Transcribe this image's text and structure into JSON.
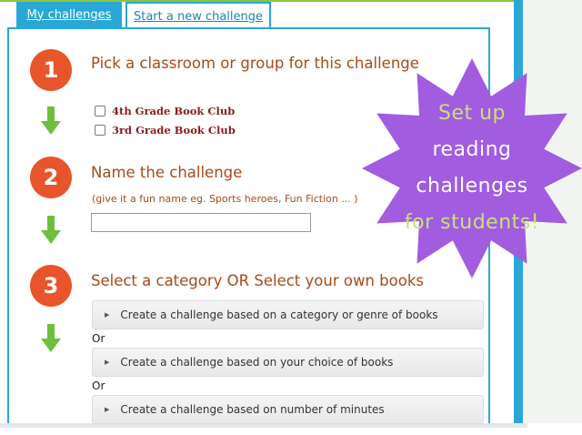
{
  "tabs": [
    {
      "label": "My challenges"
    },
    {
      "label": "Start a new challenge"
    }
  ],
  "steps": [
    {
      "number": "1",
      "title": "Pick a classroom or group for this challenge"
    },
    {
      "number": "2",
      "title": "Name the challenge",
      "hint": "(give it a fun name eg. Sports heroes, Fun Fiction ... )"
    },
    {
      "number": "3",
      "title": "Select a category OR Select your own books"
    }
  ],
  "groups": [
    {
      "label": "4th Grade Book Club"
    },
    {
      "label": "3rd Grade Book Club"
    }
  ],
  "name_field": {
    "value": "",
    "placeholder": ""
  },
  "options": [
    {
      "label": "Create a challenge based on a category or genre of books"
    },
    {
      "label": "Create a challenge based on your choice of books"
    },
    {
      "label": "Create a challenge based on number of minutes"
    }
  ],
  "or_label": "Or",
  "promo": {
    "lines": [
      "Set up",
      "reading",
      "challenges",
      "for students!"
    ],
    "colors": [
      "#c8e07a",
      "#ffffff",
      "#ffffff",
      "#c8e07a"
    ],
    "burst_color": "#a15ce0"
  },
  "colors": {
    "accent": "#29a8d8",
    "step_circle": "#e8552a",
    "arrow": "#6fbf3f",
    "heading": "#a84a1a"
  }
}
